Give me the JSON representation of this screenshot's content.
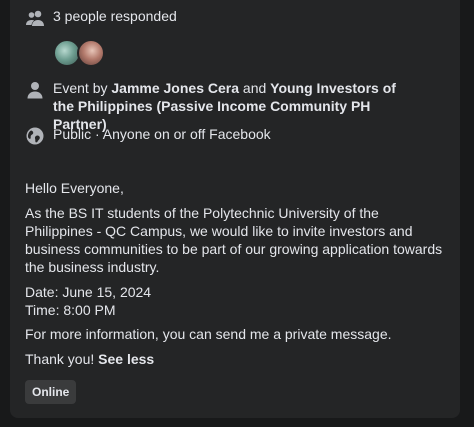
{
  "responses": {
    "text": "3 people responded"
  },
  "host": {
    "prefix": "Event by ",
    "host1": "Jamme Jones Cera",
    "joiner": " and ",
    "host2": "Young Investors of the Philippines (Passive Income Community PH Partner)"
  },
  "privacy": {
    "text": "Public · Anyone on or off Facebook"
  },
  "description": {
    "greeting": "Hello Everyone,",
    "body": "As the BS IT students of the Polytechnic University of the Philippines - QC Campus, we would like to invite investors and business communities to be part of our growing application towards the business industry.",
    "date": "Date: June 15, 2024",
    "time": "Time: 8:00 PM",
    "info": "For more information, you can send me a private message.",
    "thanks": "Thank you! ",
    "see_less": "See less"
  },
  "tag": {
    "label": "Online"
  },
  "icons": {
    "responses": "people-icon",
    "host": "person-icon",
    "privacy": "globe-icon"
  },
  "colors": {
    "card_bg": "#242526",
    "text": "#e4e6eb",
    "icon": "#b0b3b8",
    "chip_bg": "#3a3b3c"
  }
}
